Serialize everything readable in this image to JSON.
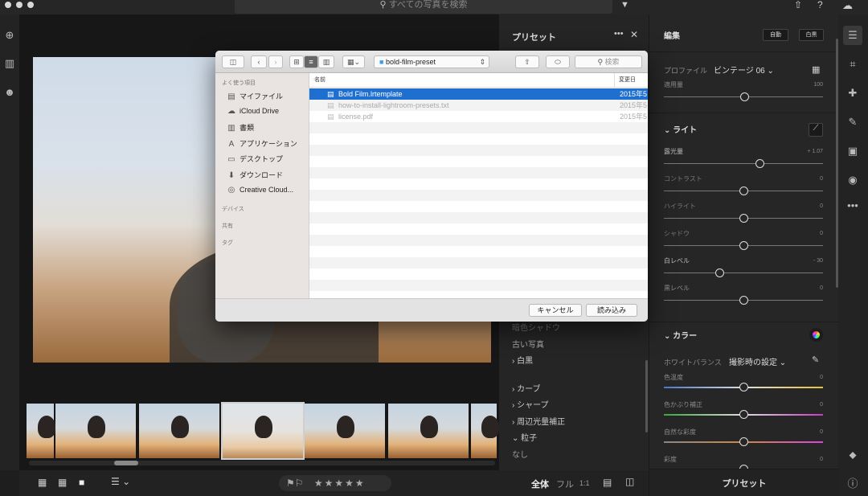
{
  "topbar": {
    "search_placeholder": "すべての写真を検索"
  },
  "presets_panel": {
    "title": "プリセット",
    "items": [
      "暗色シャドウ",
      "古い写真",
      "白黒",
      "カーブ",
      "シャープ",
      "周辺光量補正",
      "粒子",
      "なし"
    ]
  },
  "edit_panel": {
    "title": "編集",
    "auto_label": "自動",
    "bw_label": "白黒",
    "profile_label": "プロファイル",
    "profile_value": "ビンテージ 06",
    "amount_label": "適用量",
    "amount_value": "100",
    "light_title": "ライト",
    "light_sliders": [
      {
        "label": "露光量",
        "value": "+ 1.07",
        "level": 0.6
      },
      {
        "label": "コントラスト",
        "value": "0",
        "level": 0.5
      },
      {
        "label": "ハイライト",
        "value": "0",
        "level": 0.5
      },
      {
        "label": "シャドウ",
        "value": "0",
        "level": 0.5
      },
      {
        "label": "白レベル",
        "value": "- 30",
        "level": 0.35
      },
      {
        "label": "黒レベル",
        "value": "0",
        "level": 0.5
      }
    ],
    "color_title": "カラー",
    "wb_label": "ホワイトバランス",
    "wb_value": "撮影時の設定",
    "color_sliders": [
      {
        "label": "色温度",
        "value": "0"
      },
      {
        "label": "色かぶり補正",
        "value": "0"
      },
      {
        "label": "自然な彩度",
        "value": "0"
      },
      {
        "label": "彩度",
        "value": "0"
      }
    ],
    "bottom_presets": "プリセット"
  },
  "bottombar": {
    "view_all": "全体",
    "view_fit": "フル",
    "view_1to1": "1:1",
    "stars": "★★★★★"
  },
  "dialog": {
    "folder": "bold-film-preset",
    "search_placeholder": "検索",
    "sidebar_favorites": "よく使う項目",
    "sidebar_items": [
      "マイファイル",
      "iCloud Drive",
      "書類",
      "アプリケーション",
      "デスクトップ",
      "ダウンロード",
      "Creative Cloud..."
    ],
    "sidebar_devices": "デバイス",
    "sidebar_shared": "共有",
    "sidebar_tags": "タグ",
    "col_name": "名前",
    "col_date": "変更日",
    "files": [
      {
        "name": "Bold Film.lrtemplate",
        "date": "2015年5"
      },
      {
        "name": "how-to-install-lightroom-presets.txt",
        "date": "2015年5"
      },
      {
        "name": "license.pdf",
        "date": "2015年5"
      }
    ],
    "cancel_label": "キャンセル",
    "open_label": "読み込み"
  }
}
